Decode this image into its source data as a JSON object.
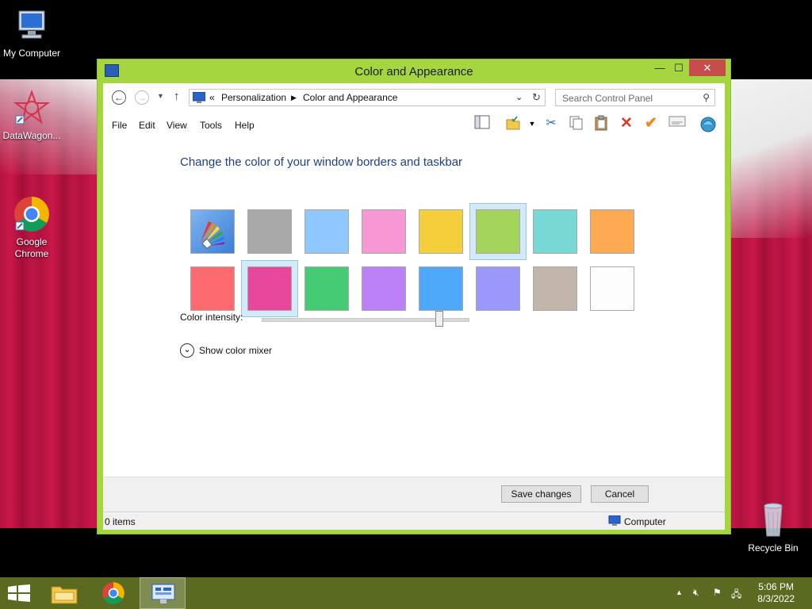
{
  "desktop": {
    "icons": [
      {
        "label": "My Computer"
      },
      {
        "label": "DataWagon..."
      },
      {
        "label": "Google\nChrome"
      },
      {
        "label": "Recycle Bin"
      }
    ]
  },
  "window": {
    "title": "Color and Appearance",
    "controls": {
      "minimize": "—",
      "maximize": "☐",
      "close": "✕"
    },
    "address": {
      "prefix": "«",
      "crumbs": [
        "Personalization",
        "Color and Appearance"
      ]
    },
    "search": {
      "placeholder": "Search Control Panel"
    },
    "menu": [
      "File",
      "Edit",
      "View",
      "Tools",
      "Help"
    ],
    "toolbar_icons": [
      "panel-icon",
      "folder-check-icon",
      "dropdown-icon",
      "cut-icon",
      "copy-icon",
      "paste-icon",
      "delete-icon",
      "checkmark-icon",
      "properties-icon",
      "shell-icon"
    ],
    "heading": "Change the color of your window borders and taskbar",
    "swatches": [
      {
        "color": "automatic",
        "selected": false
      },
      {
        "color": "#a9a9a9",
        "selected": false
      },
      {
        "color": "#8fc8ff",
        "selected": false
      },
      {
        "color": "#f598d4",
        "selected": false
      },
      {
        "color": "#f4cf3b",
        "selected": false
      },
      {
        "color": "#a5d45c",
        "selected": true
      },
      {
        "color": "#78d8d4",
        "selected": false
      },
      {
        "color": "#fdaa52",
        "selected": false
      },
      {
        "color": "#fd6a6e",
        "selected": false
      },
      {
        "color": "#e8489c",
        "selected": true
      },
      {
        "color": "#44cb73",
        "selected": false
      },
      {
        "color": "#bd81f7",
        "selected": false
      },
      {
        "color": "#4da8fa",
        "selected": false
      },
      {
        "color": "#9c97fb",
        "selected": false
      },
      {
        "color": "#c2b6aa",
        "selected": false
      },
      {
        "color": "#fdfdfd",
        "selected": false
      }
    ],
    "intensity": {
      "label": "Color intensity:",
      "value": 0.86
    },
    "mixer": {
      "label": "Show color mixer"
    },
    "buttons": {
      "save": "Save changes",
      "cancel": "Cancel"
    },
    "status": {
      "items": "0 items",
      "location": "Computer"
    }
  },
  "taskbar": {
    "time": "5:06 PM",
    "date": "8/3/2022",
    "accent": "#5a6b21"
  }
}
